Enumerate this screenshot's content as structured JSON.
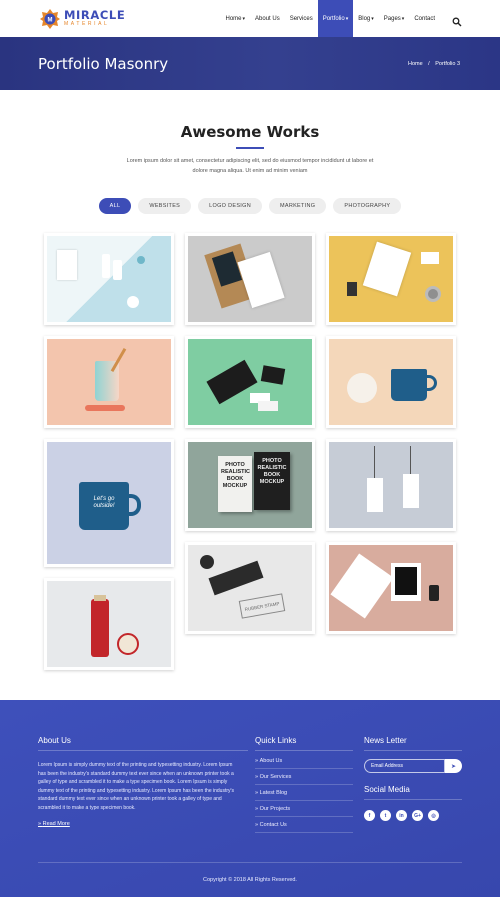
{
  "header": {
    "logo_title": "MIRACLE",
    "logo_sub": "MATERIAL",
    "nav": [
      {
        "label": "Home",
        "caret": true
      },
      {
        "label": "About Us",
        "caret": false
      },
      {
        "label": "Services",
        "caret": false
      },
      {
        "label": "Portfolio",
        "caret": true,
        "active": true
      },
      {
        "label": "Blog",
        "caret": true
      },
      {
        "label": "Pages",
        "caret": true
      },
      {
        "label": "Contact",
        "caret": false
      }
    ]
  },
  "hero": {
    "title": "Portfolio Masonry",
    "breadcrumb_home": "Home",
    "breadcrumb_sep": "/",
    "breadcrumb_current": "Portfolio 3"
  },
  "works": {
    "title": "Awesome Works",
    "description": "Lorem ipsum dolor sit amet, consectetur adipiscing elit, sed do eiusmod tempor incididunt ut labore et dolore magna aliqua. Ut enim ad minim veniam",
    "filters": [
      "ALL",
      "WEBSITES",
      "LOGO DESIGN",
      "MARKETING",
      "PHOTOGRAPHY"
    ],
    "active_filter": "ALL"
  },
  "portfolio_items": [
    {
      "name": "stationery-bottles",
      "color": "#cfe7ec"
    },
    {
      "name": "clipboard-mockup",
      "color": "#c9c9c9"
    },
    {
      "name": "yellow-stationery",
      "color": "#ecc35a"
    },
    {
      "name": "cup-mockup",
      "color": "#f1c3ab"
    },
    {
      "name": "black-notebook",
      "color": "#7ccba0"
    },
    {
      "name": "mug-tape",
      "color": "#f3d6b9"
    },
    {
      "name": "blue-mug",
      "color": "#c9cfe3"
    },
    {
      "name": "book-mockup",
      "color": "#8fa39a"
    },
    {
      "name": "tags-mockup",
      "color": "#c4cad4"
    },
    {
      "name": "rubber-stamp",
      "color": "#e6e6e6"
    },
    {
      "name": "stationery-pink",
      "color": "#d9aea0"
    },
    {
      "name": "jar-mockup",
      "color": "#e6e8ea"
    }
  ],
  "mockup_text": {
    "book_line1": "PHOTO",
    "book_line2": "REALISTIC",
    "book_line3": "BOOK",
    "book_line4": "MOCKUP",
    "mug_text": "Let's go outside!",
    "stamp_text": "RUBBER STAMP"
  },
  "footer": {
    "about_heading": "About Us",
    "about_text": "Lorem Ipsum is simply dummy text of the printing and typesetting industry. Lorem Ipsum has been the industry's standard dummy text ever since when an unknown printer took a galley of type and scrambled it to make a type specimen book. Lorem Ipsum is simply dummy text of the printing and typesetting industry. Lorem Ipsum has been the industry's standard dummy text ever since when an unknown printer took a galley of type and scrambled it to make a type specimen book.",
    "read_more": "Read More",
    "quick_heading": "Quick Links",
    "quick_links": [
      "About Us",
      "Our Services",
      "Latest Blog",
      "Our Projects",
      "Contact Us"
    ],
    "newsletter_heading": "News Letter",
    "email_placeholder": "Email Address",
    "social_heading": "Social Media",
    "socials": [
      {
        "icon": "facebook-icon",
        "glyph": "f"
      },
      {
        "icon": "twitter-icon",
        "glyph": "t"
      },
      {
        "icon": "linkedin-icon",
        "glyph": "in"
      },
      {
        "icon": "google-plus-icon",
        "glyph": "G+"
      },
      {
        "icon": "instagram-icon",
        "glyph": "◎"
      }
    ],
    "copyright": "Copyright © 2018 All Rights Reserved."
  },
  "colors": {
    "brand": "#3d4db7",
    "accent": "#e6862a",
    "hero_bg": "#2b3686",
    "footer_bg": "#3a4bb6"
  }
}
